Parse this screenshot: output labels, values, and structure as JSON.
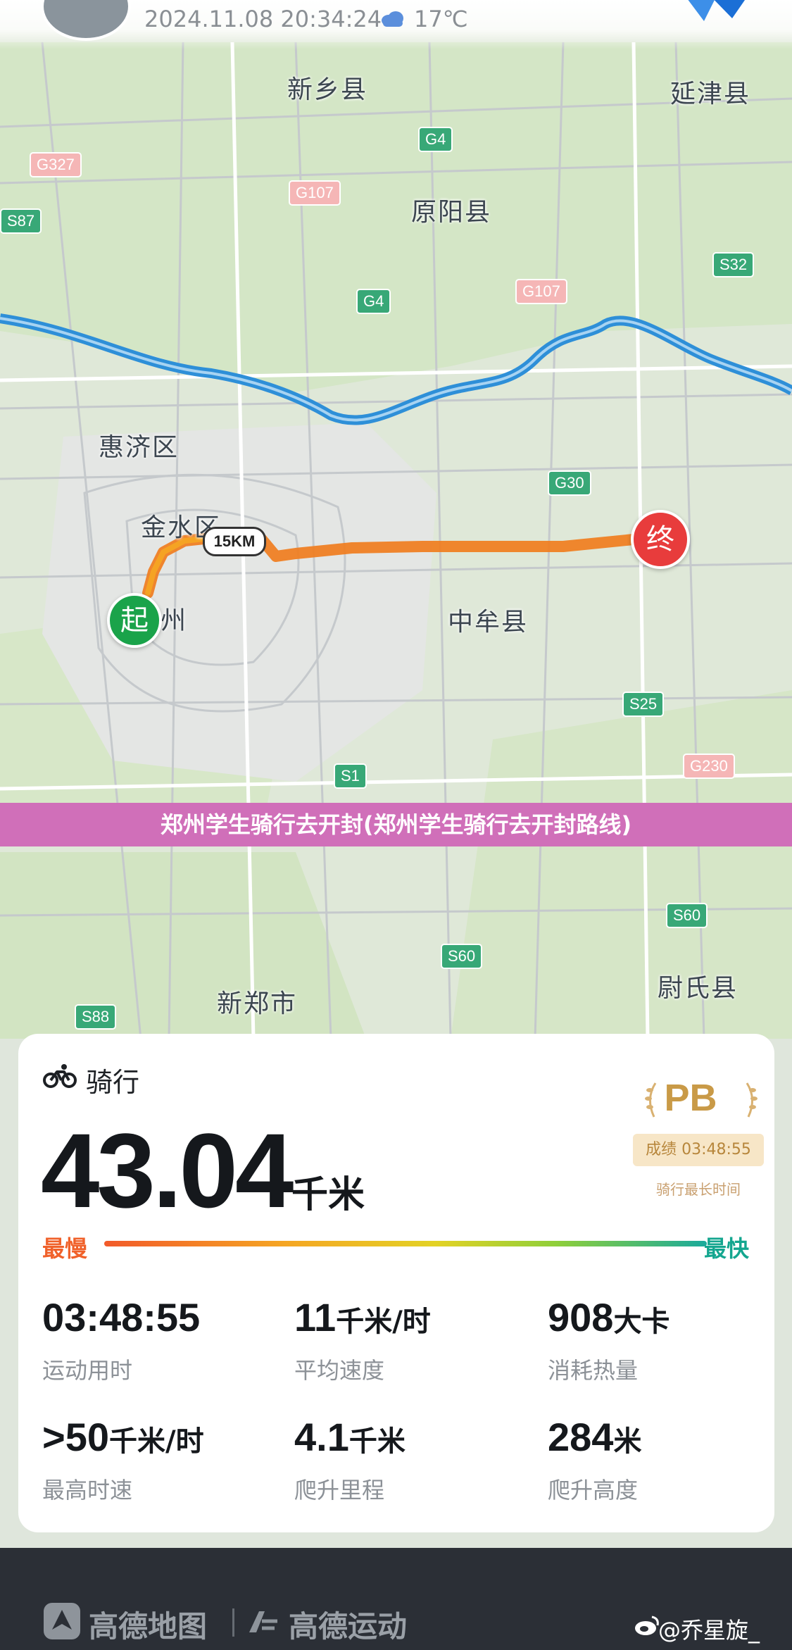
{
  "status_bar": {
    "datetime": "2024.11.08 20:34:24",
    "weather_icon": "cloud-icon",
    "temperature": "17℃"
  },
  "map": {
    "places": {
      "xinxiang": "新乡县",
      "yanjin": "延津县",
      "yuanyang": "原阳县",
      "huiji": "惠济区",
      "jinshui": "金水区",
      "zhongmu": "中牟县",
      "zhou": "州",
      "weishi": "尉氏县",
      "xinzheng": "新郑市"
    },
    "road_shields": {
      "g327": "G327",
      "s87": "S87",
      "g107a": "G107",
      "g4a": "G4",
      "g4b": "G4",
      "g107b": "G107",
      "s32": "S32",
      "g30": "G30",
      "s25": "S25",
      "g230": "G230",
      "s1": "S1",
      "s60a": "S60",
      "s60b": "S60",
      "s88": "S88"
    },
    "start_label": "起",
    "end_label": "终",
    "distance_marker": "15KM",
    "route_color": "#f07d1e"
  },
  "banner": {
    "text": "郑州学生骑行去开封(郑州学生骑行去开封路线)"
  },
  "summary": {
    "activity_icon": "bicycle-icon",
    "activity": "骑行",
    "distance": "43.04",
    "distance_unit": "千米",
    "pb": {
      "badge": "PB",
      "record": "成绩 03:48:55",
      "caption": "骑行最长时间"
    },
    "speed_legend": {
      "slow": "最慢",
      "fast": "最快"
    },
    "stats": [
      {
        "value": "03:48:55",
        "unit": "",
        "label": "运动用时"
      },
      {
        "value": "11",
        "unit": "千米/时",
        "label": "平均速度"
      },
      {
        "value": "908",
        "unit": "大卡",
        "label": "消耗热量"
      },
      {
        "value": ">50",
        "unit": "千米/时",
        "label": "最高时速"
      },
      {
        "value": "4.1",
        "unit": "千米",
        "label": "爬升里程"
      },
      {
        "value": "284",
        "unit": "米",
        "label": "爬升高度"
      }
    ]
  },
  "footer": {
    "brand1": "高德地图",
    "brand2": "高德运动",
    "watermark": "@乔星旋_"
  }
}
